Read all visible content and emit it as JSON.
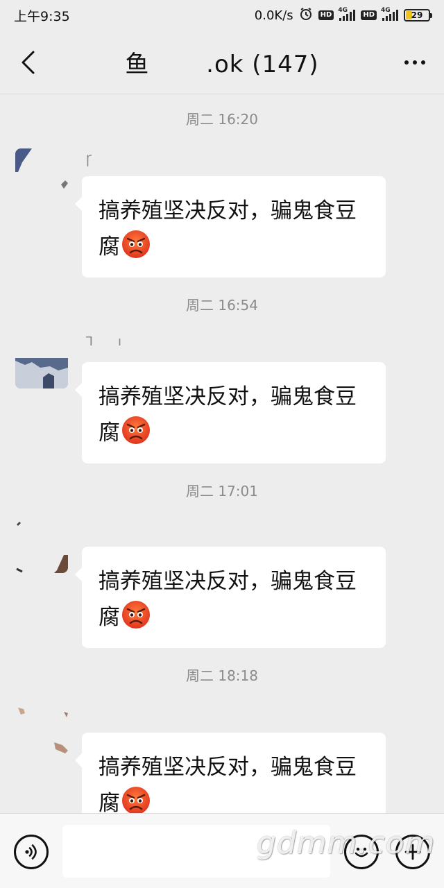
{
  "status_bar": {
    "time": "上午9:35",
    "net_speed": "0.0K/s",
    "network_1": "4G",
    "network_2": "4G",
    "hd": "HD",
    "battery_level": "29",
    "battery_fraction": 0.29
  },
  "nav": {
    "title": "鱼　　 .ok (147)"
  },
  "messages": [
    {
      "timestamp": "周二 16:20",
      "sender": "Ꞅ",
      "text": "搞养殖坚决反对，骗鬼食豆腐",
      "emoji": "angry-face"
    },
    {
      "timestamp": "周二 16:54",
      "sender": "Ꞁ　　ı",
      "text": "搞养殖坚决反对，骗鬼食豆腐",
      "emoji": "angry-face"
    },
    {
      "timestamp": "周二 17:01",
      "sender": "",
      "text": "搞养殖坚决反对，骗鬼食豆腐",
      "emoji": "angry-face"
    },
    {
      "timestamp": "周二 18:18",
      "sender": "",
      "text": "搞养殖坚决反对，骗鬼食豆腐",
      "emoji": "angry-face"
    }
  ],
  "input": {
    "placeholder": ""
  },
  "watermark": "gdmm.com",
  "colors": {
    "background": "#ededed",
    "bubble": "#ffffff",
    "timestamp": "#8a8a8a",
    "battery": "#f2c318"
  }
}
